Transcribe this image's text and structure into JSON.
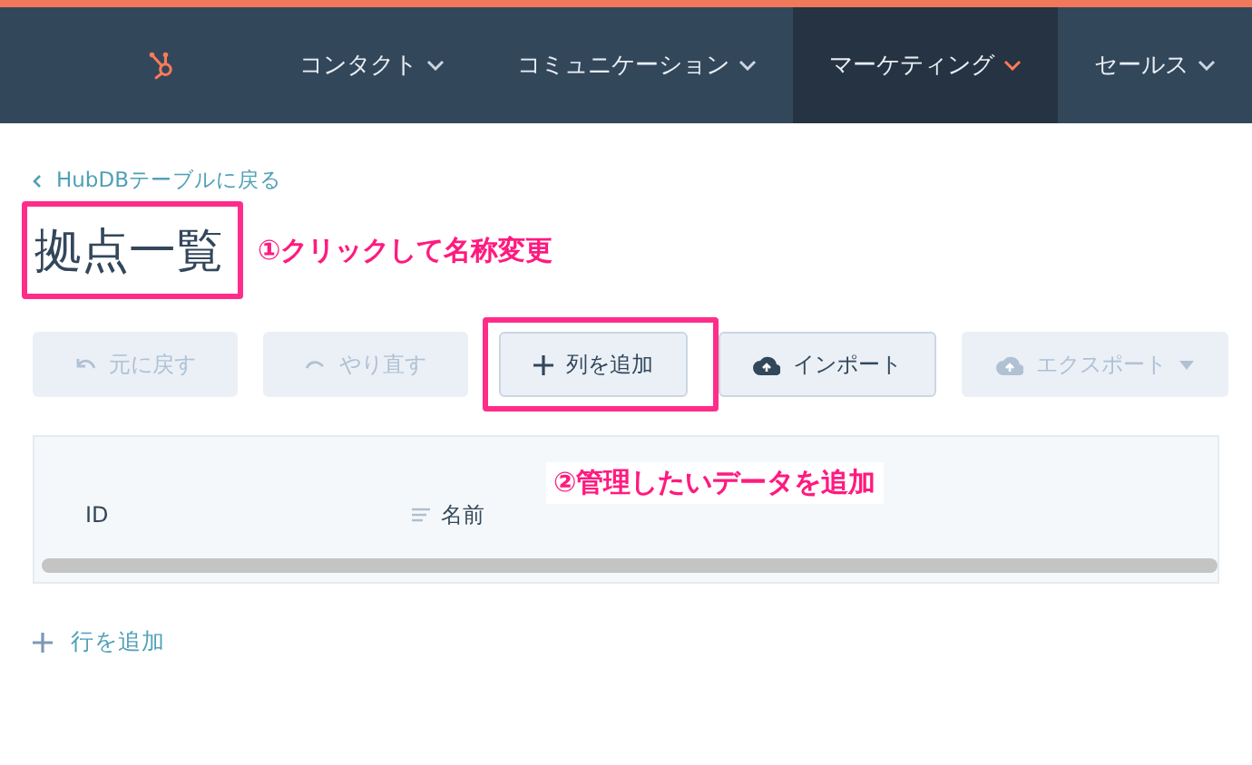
{
  "nav": {
    "items": [
      {
        "label": "コンタクト",
        "selected": false
      },
      {
        "label": "コミュニケーション",
        "selected": false
      },
      {
        "label": "マーケティング",
        "selected": true
      },
      {
        "label": "セールス",
        "selected": false
      }
    ]
  },
  "back_link": "HubDBテーブルに戻る",
  "title": "拠点一覧",
  "annotations": [
    {
      "text": "①クリックして名称変更"
    },
    {
      "text": "②管理したいデータを追加"
    }
  ],
  "toolbar": [
    {
      "kind": "undo",
      "label": "元に戻す",
      "disabled": true,
      "highlighted": false
    },
    {
      "kind": "redo",
      "label": "やり直す",
      "disabled": true,
      "highlighted": false
    },
    {
      "kind": "add",
      "label": "列を追加",
      "disabled": false,
      "highlighted": true
    },
    {
      "kind": "import",
      "label": "インポート",
      "disabled": false,
      "highlighted": false
    },
    {
      "kind": "export",
      "label": "エクスポート",
      "disabled": true,
      "highlighted": false,
      "dropdown": true
    }
  ],
  "table": {
    "columns": [
      {
        "kind": "id",
        "label": "ID"
      },
      {
        "kind": "text",
        "label": "名前"
      }
    ]
  },
  "add_row": "行を追加"
}
